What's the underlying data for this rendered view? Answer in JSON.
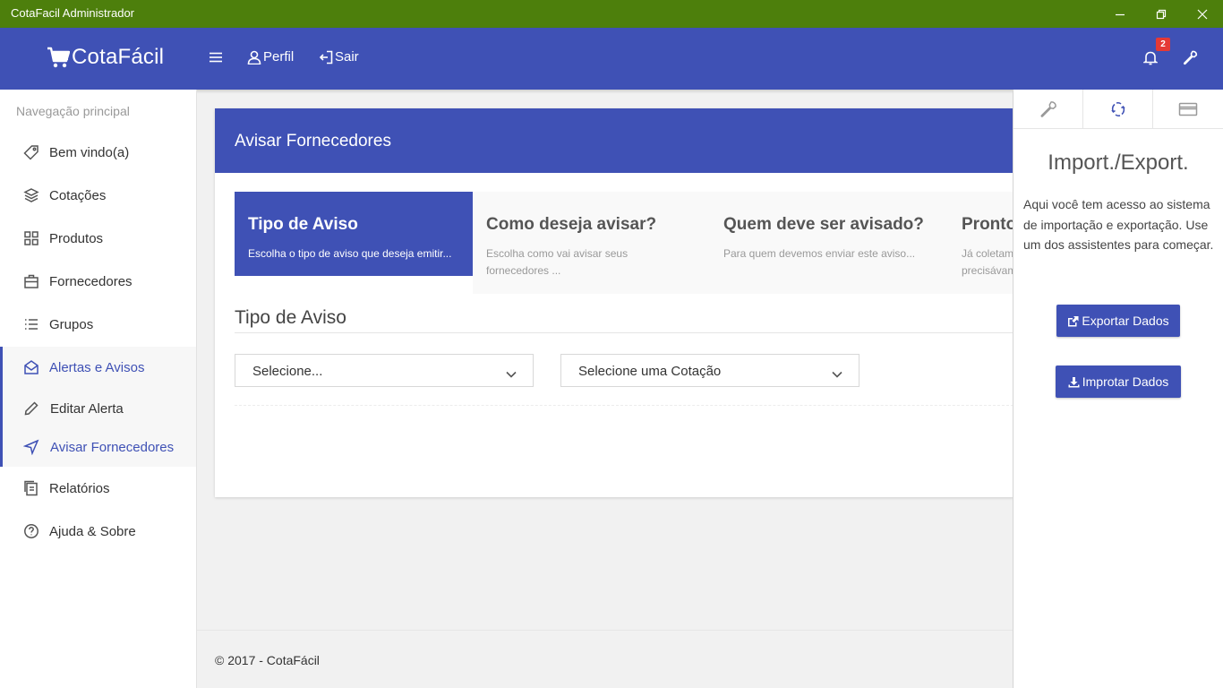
{
  "window": {
    "title": "CotaFacil Administrador"
  },
  "header": {
    "brand": "CotaFácil",
    "profile_label": "Perfil",
    "logout_label": "Sair",
    "notification_count": "2"
  },
  "sidebar": {
    "section_label": "Navegação principal",
    "items": [
      {
        "label": "Bem vindo(a)",
        "icon": "tag-icon"
      },
      {
        "label": "Cotações",
        "icon": "layers-icon"
      },
      {
        "label": "Produtos",
        "icon": "grid-icon"
      },
      {
        "label": "Fornecedores",
        "icon": "briefcase-icon"
      },
      {
        "label": "Grupos",
        "icon": "list-icon"
      },
      {
        "label": "Alertas e Avisos",
        "icon": "envelope-open-icon"
      },
      {
        "label": "Editar Alerta",
        "icon": "pencil-icon"
      },
      {
        "label": "Avisar Fornecedores",
        "icon": "send-icon"
      },
      {
        "label": "Relatórios",
        "icon": "reports-icon"
      },
      {
        "label": "Ajuda & Sobre",
        "icon": "help-icon"
      }
    ]
  },
  "main": {
    "card_title": "Avisar Fornecedores",
    "steps": [
      {
        "title": "Tipo de Aviso",
        "desc": "Escolha o tipo de aviso que deseja emitir..."
      },
      {
        "title": "Como deseja avisar?",
        "desc": "Escolha como vai avisar seus fornecedores ..."
      },
      {
        "title": "Quem deve ser avisado?",
        "desc": "Para quem devemos enviar este aviso..."
      },
      {
        "title": "Pronto!",
        "desc": "Já coletamos tudo que precisávamos..."
      }
    ],
    "section_title": "Tipo de Aviso",
    "select_type": "Selecione...",
    "select_quote": "Selecione uma Cotação"
  },
  "footer": {
    "text": "© 2017 - CotaFácil"
  },
  "panel": {
    "title": "Import./Export.",
    "description": "Aqui você tem acesso ao sistema de importação e exportação. Use um dos assistentes para começar.",
    "export_label": "Exportar Dados",
    "import_label": "Improtar Dados"
  },
  "colors": {
    "titlebar": "#4d7f0c",
    "primary": "#3f51b5",
    "badge": "#e53935"
  }
}
